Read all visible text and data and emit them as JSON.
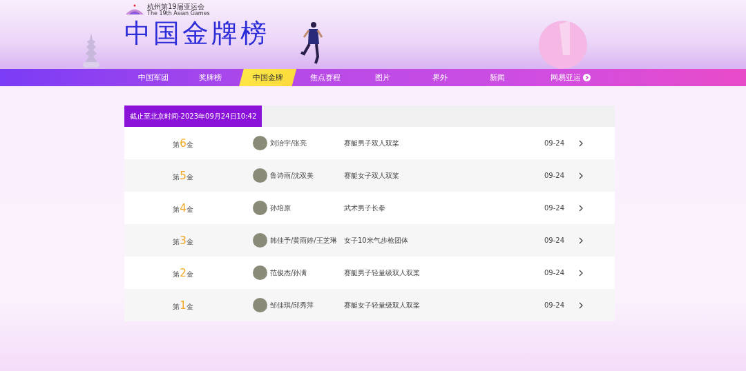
{
  "logo": {
    "title": "杭州第19届亚运会",
    "subtitle": "The 19th Asian Games"
  },
  "page_title": "中国金牌榜",
  "nav": [
    {
      "label": "中国军团",
      "selected": false
    },
    {
      "label": "奖牌榜",
      "selected": false
    },
    {
      "label": "中国金牌",
      "selected": true
    },
    {
      "label": "焦点赛程",
      "selected": false
    },
    {
      "label": "图片",
      "selected": false
    },
    {
      "label": "界外",
      "selected": false
    },
    {
      "label": "新闻",
      "selected": false
    }
  ],
  "brand_link": "网易亚运",
  "updated": "截止至北京时间-2023年09月24日10:42",
  "rows": [
    {
      "before": "第",
      "number": "6",
      "after": "金",
      "athletes": "刘治宇/张亮",
      "event": "赛艇男子双人双桨",
      "date": "09-24"
    },
    {
      "before": "第",
      "number": "5",
      "after": "金",
      "athletes": "鲁诗雨/沈双美",
      "event": "赛艇女子双人双桨",
      "date": "09-24"
    },
    {
      "before": "第",
      "number": "4",
      "after": "金",
      "athletes": "孙培原",
      "event": "武术男子长拳",
      "date": "09-24"
    },
    {
      "before": "第",
      "number": "3",
      "after": "金",
      "athletes": "韩佳予/黄雨婷/王芝琳",
      "event": "女子10米气步枪团体",
      "date": "09-24"
    },
    {
      "before": "第",
      "number": "2",
      "after": "金",
      "athletes": "范俊杰/孙满",
      "event": "赛艇男子轻量级双人双桨",
      "date": "09-24"
    },
    {
      "before": "第",
      "number": "1",
      "after": "金",
      "athletes": "邹佳琪/邱秀萍",
      "event": "赛艇女子轻量级双人双桨",
      "date": "09-24"
    }
  ]
}
